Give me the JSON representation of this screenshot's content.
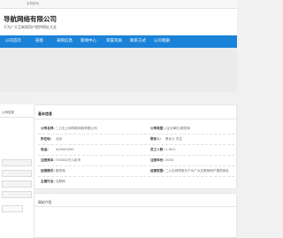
{
  "topbar": {
    "mobile_link": "手机访问"
  },
  "header": {
    "title": "导航网络有限公司",
    "slogan": "于为广大互联网用户提供网址大全"
  },
  "nav": [
    {
      "label": "公司首页"
    },
    {
      "label": "链接"
    },
    {
      "label": "采购信息"
    },
    {
      "label": "新闻中心"
    },
    {
      "label": "荣誉资质"
    },
    {
      "label": "联系方式"
    },
    {
      "label": "公司相册"
    }
  ],
  "sidebar": {
    "heading": "公司信息"
  },
  "basic_info": {
    "title": "基本信息",
    "rows": [
      {
        "label": "公司名称：",
        "value": "二六五上网导航网络有限公司",
        "label2": "公司类型：",
        "value2": "(企业单位)服务商"
      },
      {
        "label": "所在地：",
        "value": "北京",
        "label2": "联系人：",
        "value2": "蔡女士 先生"
      },
      {
        "label": "电话：",
        "value": "400000000",
        "label2": "员工人数：",
        "value2": "1-49人"
      },
      {
        "label": "注册资本：",
        "value": "700000万人民币",
        "label2": "注册年份：",
        "value2": "2004"
      },
      {
        "label": "经营模式：",
        "value": "服务商",
        "label2": "经营范围：",
        "value2": "二六五网导航为于为广大互联网用户提供网址"
      },
      {
        "label": "主营行业：",
        "value": "互联网"
      }
    ]
  },
  "intro": {
    "title": "网站介绍"
  }
}
